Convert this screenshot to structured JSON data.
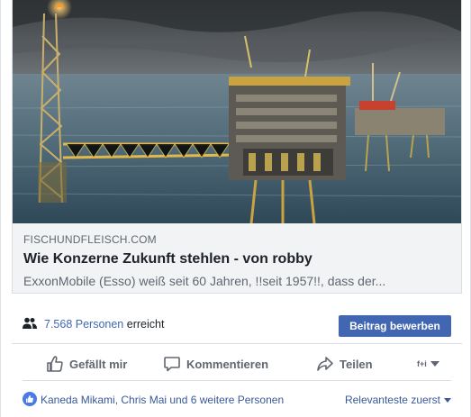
{
  "link_preview": {
    "domain": "FISCHUNDFLEISCH.COM",
    "title": "Wie Konzerne Zukunft stehlen - von robby",
    "description": "ExxonMobile (Esso) weiß seit 60 Jahren, !!seit 1957!!, dass der..."
  },
  "reach": {
    "count": "7.568 Personen",
    "suffix": "erreicht",
    "boost_label": "Beitrag bewerben"
  },
  "actions": {
    "like_label": "Gefällt mir",
    "comment_label": "Kommentieren",
    "share_label": "Teilen"
  },
  "reactions": {
    "names": "Kaneda Mikami, Chris Mai und 6 weitere Personen",
    "sort_label": "Relevanteste zuerst"
  },
  "colors": {
    "brand": "#4267b2",
    "link": "#385898",
    "muted": "#606770"
  },
  "icons": [
    "people-icon",
    "thumbs-up-icon",
    "comment-icon",
    "share-icon",
    "chevron-down-icon",
    "like-reaction-icon"
  ]
}
